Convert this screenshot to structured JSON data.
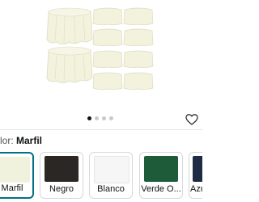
{
  "color_selector": {
    "label_prefix": "lor:",
    "selected_value": "Marfil"
  },
  "carousel": {
    "dot_count": 4,
    "active_index": 0
  },
  "swatches": [
    {
      "label": "Marfil",
      "color": "#f1f2de",
      "selected": true
    },
    {
      "label": "Negro",
      "color": "#2a2724",
      "selected": false
    },
    {
      "label": "Blanco",
      "color": "#f6f6f6",
      "selected": false
    },
    {
      "label": "Verde O...",
      "color": "#1e5b38",
      "selected": false
    },
    {
      "label": "Azu",
      "color": "#1f2a44",
      "selected": false
    }
  ],
  "colors": {
    "tablecloth": "#f3f2dc",
    "tablecloth_shadow": "#dcdbc3",
    "selected_border": "#007185"
  },
  "icons": {
    "favorite": "heart-outline-icon"
  }
}
